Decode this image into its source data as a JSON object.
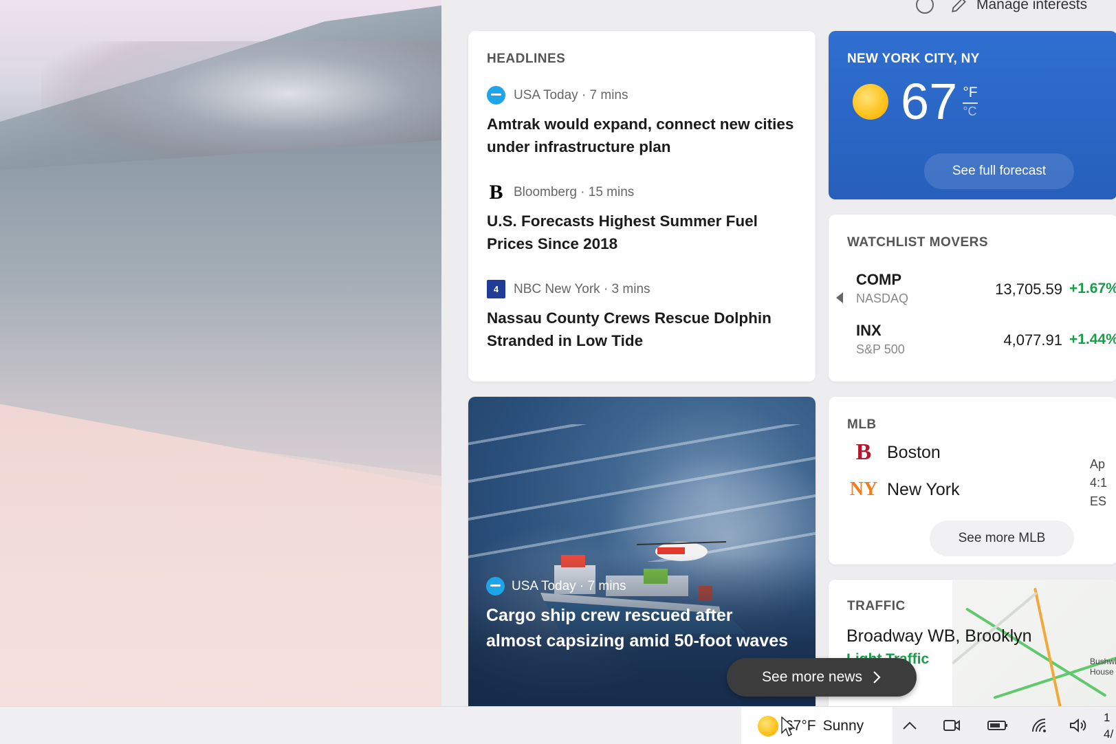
{
  "panel": {
    "manage_label": "Manage interests"
  },
  "headlines": {
    "title": "HEADLINES",
    "items": [
      {
        "source": "USA Today · 7 mins",
        "title": "Amtrak would expand, connect new cities under infrastructure plan",
        "logo": "usa-today-logo"
      },
      {
        "source": "Bloomberg · 15 mins",
        "title": "U.S. Forecasts Highest Summer Fuel Prices Since 2018",
        "logo": "bloomberg-logo"
      },
      {
        "source": "NBC New York · 3 mins",
        "title": "Nassau County Crews Rescue Dolphin Stranded in Low Tide",
        "logo": "nbc-logo"
      }
    ]
  },
  "weather": {
    "city": "NEW YORK CITY, NY",
    "temp": "67",
    "unit_f": "°F",
    "unit_c": "°C",
    "forecast_label": "See full forecast",
    "color": "#2f6fd0"
  },
  "watchlist": {
    "title": "WATCHLIST MOVERS",
    "stocks": [
      {
        "symbol": "COMP",
        "exchange": "NASDAQ",
        "price": "13,705.59",
        "change": "+1.67%"
      },
      {
        "symbol": "INX",
        "exchange": "S&P 500",
        "price": "4,077.91",
        "change": "+1.44%"
      }
    ],
    "positive_color": "#1a9d4b"
  },
  "feature": {
    "source": "USA Today · 7 mins",
    "title": "Cargo ship crew rescued after almost capsizing amid 50-foot waves"
  },
  "mlb": {
    "title": "MLB",
    "teams": [
      {
        "name": "Boston",
        "logo_letter": "B",
        "color": "#b3172b"
      },
      {
        "name": "New York",
        "logo_letter": "NY",
        "color": "#f07d1f"
      }
    ],
    "time_line1": "Ap",
    "time_line2": "4:1",
    "time_line3": "ES",
    "more_label": "See more MLB"
  },
  "traffic": {
    "title": "TRAFFIC",
    "location": "Broadway WB, Brooklyn",
    "status": "Light Traffic",
    "map_label1": "Bushwi",
    "map_label2": "House"
  },
  "see_more_news": "See more news",
  "taskbar": {
    "weather_text": "67°F",
    "weather_cond": "Sunny",
    "clock_line1": "1",
    "clock_line2": "4/"
  }
}
